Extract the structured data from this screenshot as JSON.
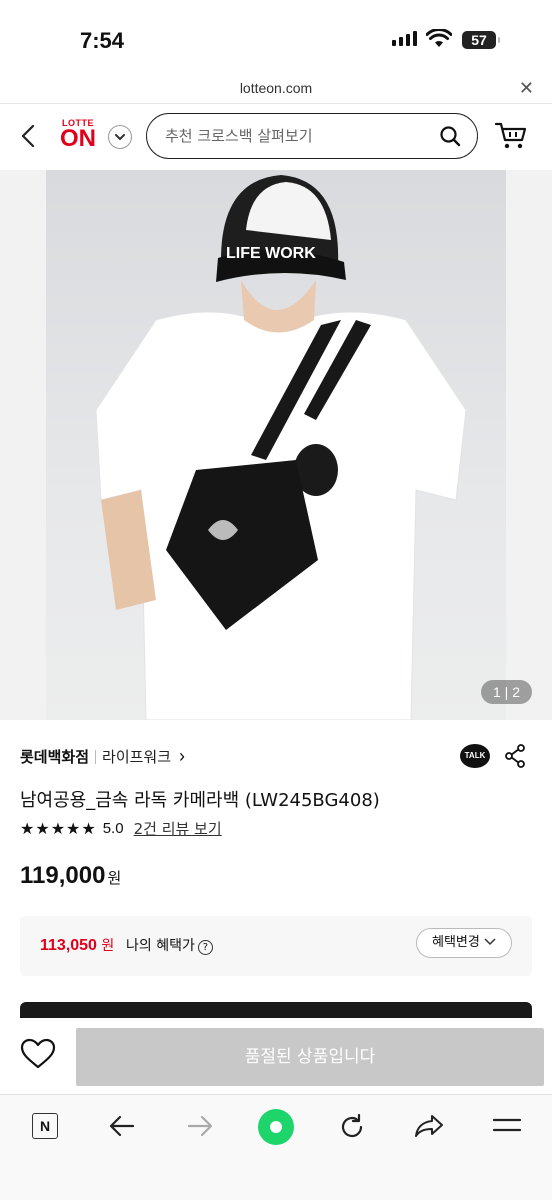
{
  "status": {
    "time": "7:54",
    "battery": "57"
  },
  "browser_url": {
    "domain": "lotteon.com"
  },
  "header": {
    "logo_top": "LOTTE",
    "logo_main": "ON",
    "search_placeholder": "추천 크로스백 살펴보기"
  },
  "gallery": {
    "current": "1",
    "total": "2"
  },
  "product": {
    "brand": "롯데백화점",
    "sub_brand": "라이프워크",
    "title": "남여공용_금속 라독 카메라백 (LW245BG408)",
    "stars": "★★★★★",
    "rating": "5.0",
    "reviews_link": "2건 리뷰 보기",
    "price": "119,000",
    "price_unit": "원"
  },
  "benefit": {
    "price": "113,050",
    "price_unit": "원",
    "label": "나의 혜택가",
    "change_button": "혜택변경"
  },
  "action": {
    "soldout_label": "품절된 상품입니다"
  },
  "talk_label": "TALK",
  "nav": {
    "n_label": "N"
  },
  "colors": {
    "brand_red": "#e0001a",
    "home_green": "#1ed56b",
    "disabled": "#c8c8c8"
  }
}
